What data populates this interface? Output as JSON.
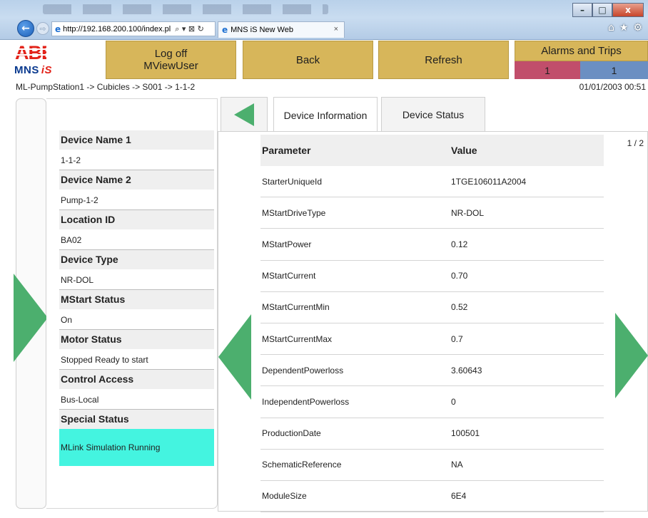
{
  "browser": {
    "url": "http://192.168.200.100/index.pl",
    "tab_title": "MNS iS New Web",
    "tab_close": "×",
    "win_minimize": "–",
    "win_maximize": "□",
    "win_close": "x",
    "back_glyph": "←",
    "forward_glyph": "⇨",
    "address_tools": "⌕ ▾ ⊠ ↻",
    "home_icon": "⌂",
    "favorites_icon": "★",
    "tools_icon": "⚙"
  },
  "brand": {
    "logo_text": "ABB",
    "product": "MNS",
    "product_suffix": "iS"
  },
  "header": {
    "logoff_line1": "Log off",
    "logoff_line2": "MViewUser",
    "back_label": "Back",
    "refresh_label": "Refresh",
    "alarms_title": "Alarms and Trips",
    "alarms_count": "1",
    "trips_count": "1",
    "colors": {
      "button": "#d7b65a",
      "alarm": "#c14e6b",
      "trip": "#6b8fc2",
      "arrow": "#4caf6e",
      "special": "#44f4e0"
    }
  },
  "breadcrumb": "ML-PumpStation1 -> Cubicles -> S001 -> 1-1-2",
  "datetime": "01/01/2003 00:51",
  "device_info": [
    {
      "label": "Device Name 1",
      "value": "1-1-2"
    },
    {
      "label": "Device Name 2",
      "value": "Pump-1-2"
    },
    {
      "label": "Location ID",
      "value": "BA02"
    },
    {
      "label": "Device Type",
      "value": "NR-DOL"
    },
    {
      "label": "MStart Status",
      "value": "On"
    },
    {
      "label": "Motor Status",
      "value": "Stopped Ready to start"
    },
    {
      "label": "Control Access",
      "value": "Bus-Local"
    },
    {
      "label": "Special Status",
      "value": "MLink Simulation Running"
    }
  ],
  "tabs": {
    "device_information": "Device Information",
    "device_status": "Device Status"
  },
  "page_indicator": "1 / 2",
  "table": {
    "headers": [
      "Parameter",
      "Value"
    ],
    "rows": [
      [
        "StarterUniqueId",
        "1TGE106011A2004"
      ],
      [
        "MStartDriveType",
        "NR-DOL"
      ],
      [
        "MStartPower",
        "0.12"
      ],
      [
        "MStartCurrent",
        "0.70"
      ],
      [
        "MStartCurrentMin",
        "0.52"
      ],
      [
        "MStartCurrentMax",
        "0.7"
      ],
      [
        "DependentPowerloss",
        "3.60643"
      ],
      [
        "IndependentPowerloss",
        "0"
      ],
      [
        "ProductionDate",
        "100501"
      ],
      [
        "SchematicReference",
        "NA"
      ],
      [
        "ModuleSize",
        "6E4"
      ]
    ]
  }
}
